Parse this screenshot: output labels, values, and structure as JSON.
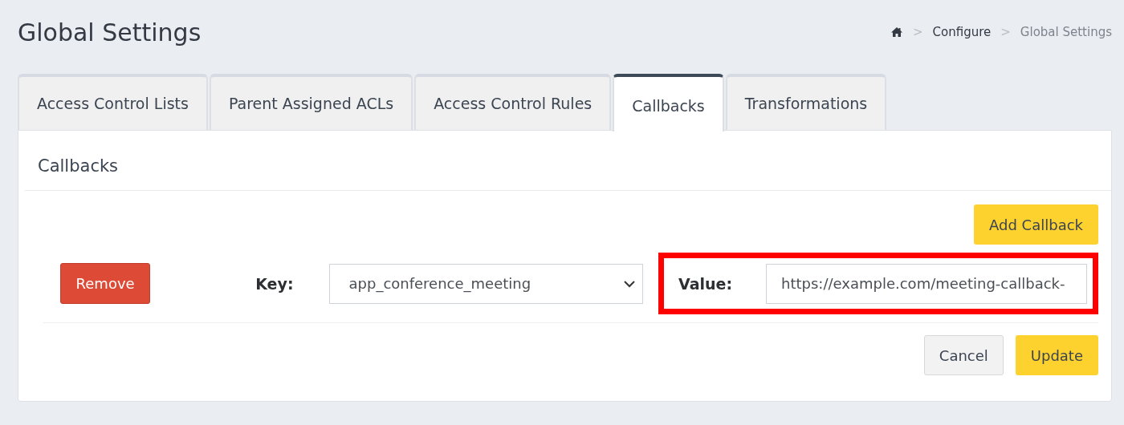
{
  "page": {
    "title": "Global Settings"
  },
  "breadcrumb": [
    {
      "separator": ">",
      "label": "Configure",
      "current": false
    },
    {
      "separator": ">",
      "label": "Global Settings",
      "current": true
    }
  ],
  "tabs": [
    {
      "label": "Access Control Lists",
      "selected": false
    },
    {
      "label": "Parent Assigned ACLs",
      "selected": false
    },
    {
      "label": "Access Control Rules",
      "selected": false
    },
    {
      "label": "Callbacks",
      "selected": true
    },
    {
      "label": "Transformations",
      "selected": false
    }
  ],
  "panel": {
    "title": "Callbacks",
    "add_button": "Add Callback",
    "callbacks": [
      {
        "remove_button": "Remove",
        "key_label": "Key:",
        "key_value": "app_conference_meeting",
        "value_label": "Value:",
        "value": "https://example.com/meeting-callback-",
        "highlighted": true
      }
    ],
    "buttons": [
      {
        "label": "Cancel",
        "kind": "secondary"
      },
      {
        "label": "Update",
        "kind": "primary"
      }
    ]
  }
}
